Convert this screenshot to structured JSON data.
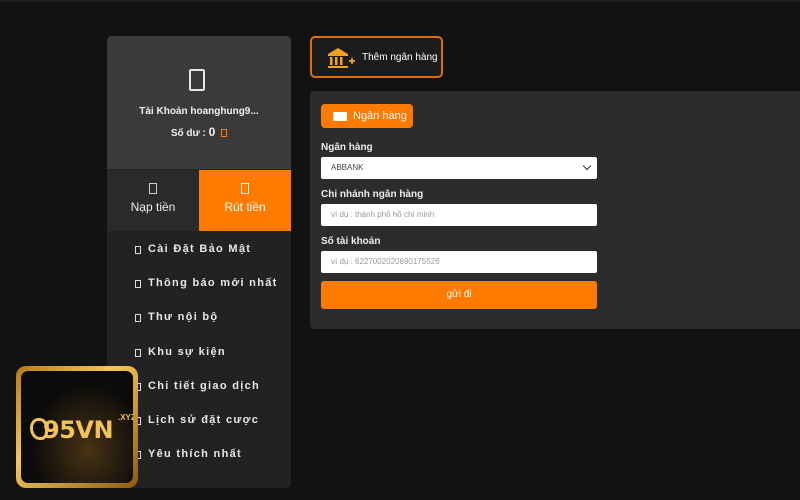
{
  "account": {
    "name": "Tài Khoản hoanghung9...",
    "balance_label": "Số dư :",
    "balance_value": "0"
  },
  "tabs": [
    {
      "label": "Nạp tiền",
      "active": false
    },
    {
      "label": "Rút tiền",
      "active": true
    }
  ],
  "menu": [
    {
      "label": "Cài Đặt Bảo Mật"
    },
    {
      "label": "Thông báo mới nhất"
    },
    {
      "label": "Thư nội bộ"
    },
    {
      "label": "Khu sự kiện"
    },
    {
      "label": "Chi tiết giao dịch"
    },
    {
      "label": "Lịch sử đặt cược"
    },
    {
      "label": "Yêu thích nhất"
    }
  ],
  "add_bank": {
    "label": "Thêm ngân hàng"
  },
  "form": {
    "tab_label": "Ngân hàng",
    "bank_label": "Ngân hàng",
    "bank_value": "ABBANK",
    "branch_label": "Chi nhánh ngân hàng",
    "branch_placeholder": "ví dụ : thành phố hồ chí minh",
    "account_label": "Số tài khoản",
    "account_placeholder": "ví dụ : 6227002020690175526",
    "submit_label": "gửi đi"
  },
  "logo": {
    "text": "95VN",
    "suffix": ".XYZ"
  },
  "colors": {
    "accent": "#ff7a00",
    "sidebar": "#222222",
    "panel": "#2c2c2c",
    "background": "#121212"
  }
}
